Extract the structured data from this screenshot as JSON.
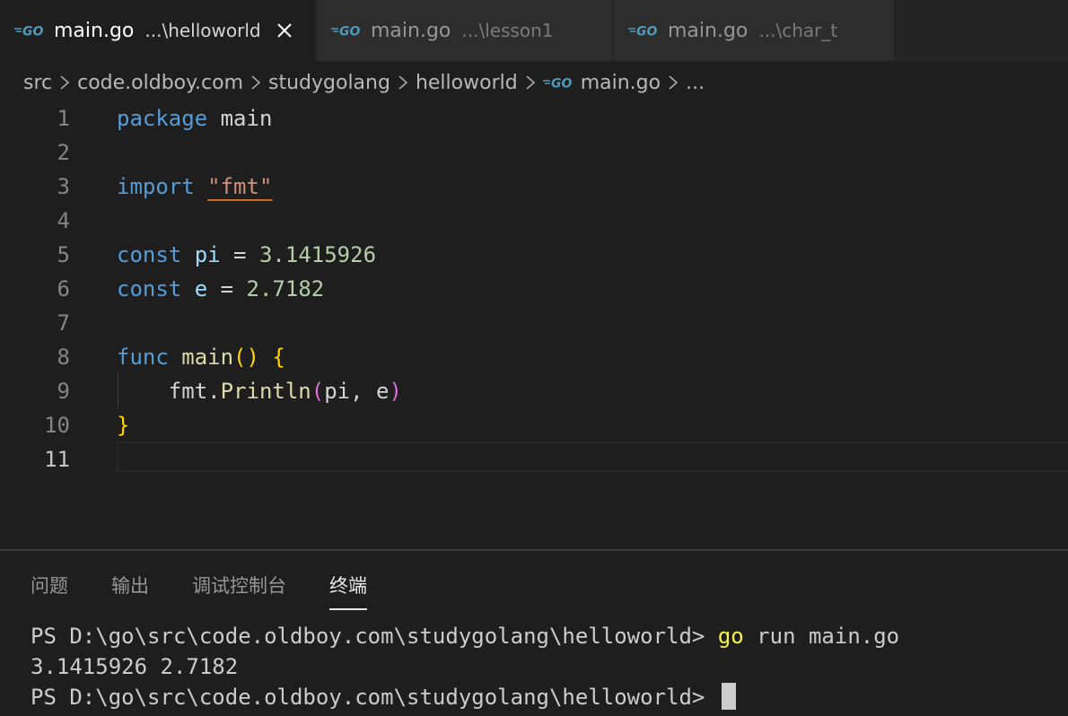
{
  "tabs": [
    {
      "file": "main.go",
      "dir": "...\\helloworld",
      "active": true,
      "close": "×"
    },
    {
      "file": "main.go",
      "dir": "...\\lesson1",
      "active": false
    },
    {
      "file": "main.go",
      "dir": "...\\char_t",
      "active": false
    }
  ],
  "breadcrumb": {
    "items": [
      "src",
      "code.oldboy.com",
      "studygolang",
      "helloworld"
    ],
    "file": "main.go",
    "more": "..."
  },
  "editor": {
    "current_line": 11,
    "lines": [
      {
        "n": "1",
        "tokens": [
          {
            "t": "package",
            "c": "kw"
          },
          {
            "t": " main",
            "c": "plain"
          }
        ]
      },
      {
        "n": "2",
        "tokens": []
      },
      {
        "n": "3",
        "tokens": [
          {
            "t": "import",
            "c": "kw"
          },
          {
            "t": " ",
            "c": "plain"
          },
          {
            "t": "\"fmt\"",
            "c": "str"
          }
        ]
      },
      {
        "n": "4",
        "tokens": []
      },
      {
        "n": "5",
        "tokens": [
          {
            "t": "const",
            "c": "kw"
          },
          {
            "t": " pi",
            "c": "ident"
          },
          {
            "t": " = ",
            "c": "plain"
          },
          {
            "t": "3.1415926",
            "c": "num"
          }
        ]
      },
      {
        "n": "6",
        "tokens": [
          {
            "t": "const",
            "c": "kw"
          },
          {
            "t": " e",
            "c": "ident"
          },
          {
            "t": " = ",
            "c": "plain"
          },
          {
            "t": "2.7182",
            "c": "num"
          }
        ]
      },
      {
        "n": "7",
        "tokens": []
      },
      {
        "n": "8",
        "tokens": [
          {
            "t": "func",
            "c": "kw"
          },
          {
            "t": " main",
            "c": "fn"
          },
          {
            "t": "()",
            "c": "brace1"
          },
          {
            "t": " ",
            "c": "plain"
          },
          {
            "t": "{",
            "c": "brace1"
          }
        ]
      },
      {
        "n": "9",
        "tokens": [
          {
            "t": "    fmt.",
            "c": "plain"
          },
          {
            "t": "Println",
            "c": "fn"
          },
          {
            "t": "(",
            "c": "brace2"
          },
          {
            "t": "pi, e",
            "c": "plain"
          },
          {
            "t": ")",
            "c": "brace2"
          }
        ]
      },
      {
        "n": "10",
        "tokens": [
          {
            "t": "}",
            "c": "brace1"
          }
        ]
      },
      {
        "n": "11",
        "tokens": []
      }
    ]
  },
  "panel": {
    "tabs": [
      {
        "label": "问题",
        "active": false
      },
      {
        "label": "输出",
        "active": false
      },
      {
        "label": "调试控制台",
        "active": false
      },
      {
        "label": "终端",
        "active": true
      }
    ],
    "terminal": {
      "line1_prompt": "PS D:\\go\\src\\code.oldboy.com\\studygolang\\helloworld> ",
      "line1_go": "go",
      "line1_rest": " run main.go",
      "line2": "3.1415926 2.7182",
      "line3_prompt": "PS D:\\go\\src\\code.oldboy.com\\studygolang\\helloworld> "
    }
  },
  "colors": {
    "go_icon": "#519aba",
    "keyword": "#569cd6",
    "string": "#ce9178",
    "number": "#b5cea8",
    "function": "#dcdcaa",
    "terminal_command": "#f5f543"
  }
}
